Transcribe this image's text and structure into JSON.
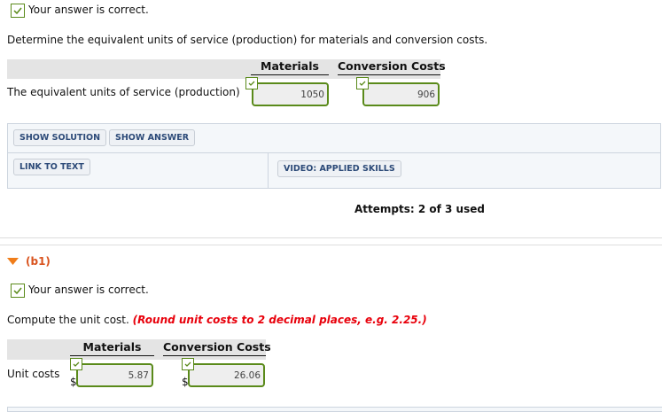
{
  "part_a": {
    "feedback": "Your answer is correct.",
    "question": "Determine the equivalent units of service (production) for materials and conversion costs.",
    "col_materials": "Materials",
    "col_conversion": "Conversion Costs",
    "row_label": "The equivalent units of service (production)",
    "materials_value": "1050",
    "conversion_value": "906"
  },
  "buttons": {
    "show_solution": "SHOW SOLUTION",
    "show_answer": "SHOW ANSWER",
    "link_to_text": "LINK TO TEXT",
    "video": "VIDEO: APPLIED SKILLS"
  },
  "attempts": "Attempts: 2 of 3 used",
  "part_b1": {
    "label": "(b1)",
    "feedback": "Your answer is correct.",
    "question": "Compute the unit cost.",
    "instruction": "(Round unit costs to 2 decimal places, e.g. 2.25.)",
    "col_materials": "Materials",
    "col_conversion": "Conversion Costs",
    "row_label": "Unit costs",
    "currency": "$",
    "materials_value": "5.87",
    "conversion_value": "26.06"
  },
  "colors": {
    "correct_green": "#5a8a1a",
    "section_orange": "#d9531e",
    "instruction_red": "#e8000b"
  }
}
